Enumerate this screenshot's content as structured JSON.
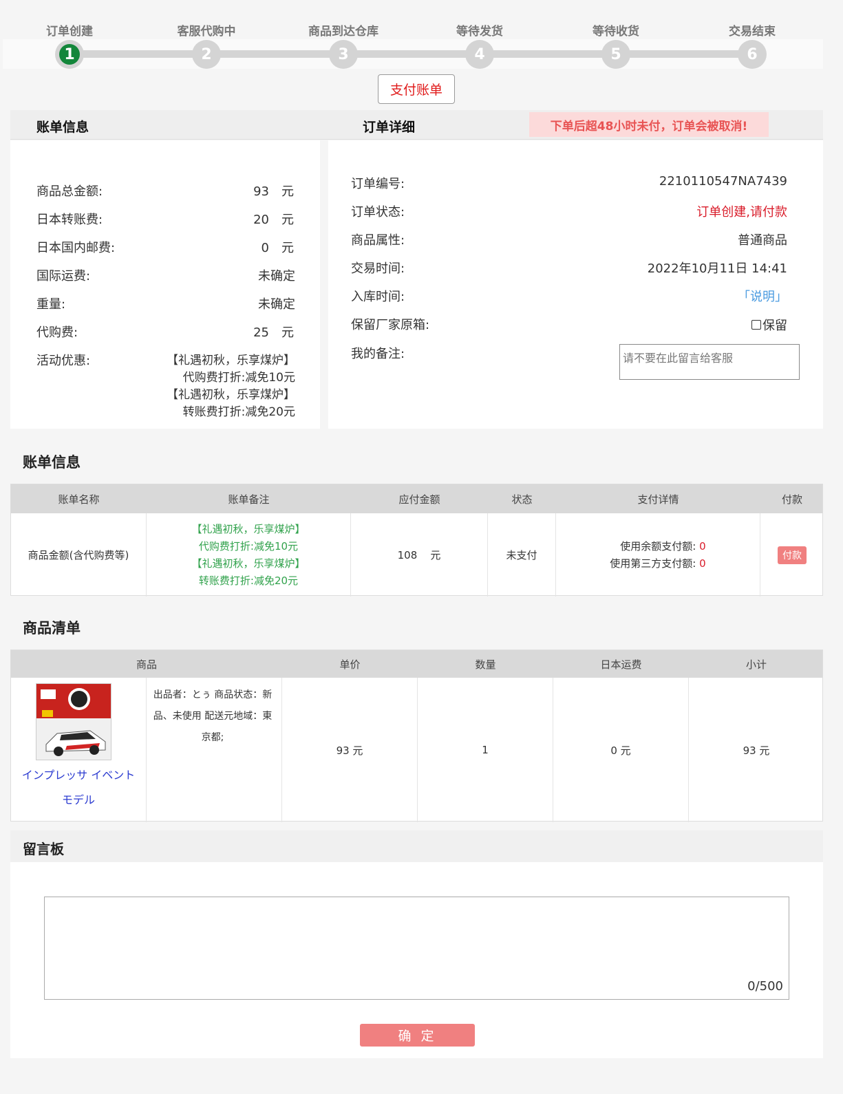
{
  "steps": [
    {
      "label": "订单创建",
      "num": "1"
    },
    {
      "label": "客服代购中",
      "num": "2"
    },
    {
      "label": "商品到达仓库",
      "num": "3"
    },
    {
      "label": "等待发货",
      "num": "4"
    },
    {
      "label": "等待收货",
      "num": "5"
    },
    {
      "label": "交易结束",
      "num": "6"
    }
  ],
  "pay_bill_button": "支付账单",
  "left_panel": {
    "title": "账单信息",
    "rows": [
      {
        "label": "商品总金额:",
        "value": "93",
        "unit": "元"
      },
      {
        "label": "日本转账费:",
        "value": "20",
        "unit": "元"
      },
      {
        "label": "日本国内邮费:",
        "value": "0",
        "unit": "元"
      },
      {
        "label": "国际运费:",
        "value": "未确定",
        "unit": ""
      },
      {
        "label": "重量:",
        "value": "未确定",
        "unit": ""
      },
      {
        "label": "代购费:",
        "value": "25",
        "unit": "元"
      }
    ],
    "promo_label": "活动优惠:",
    "promo_lines": [
      "【礼遇初秋，乐享煤炉】",
      "代购费打折:减免10元",
      "【礼遇初秋，乐享煤炉】",
      "转账费打折:减免20元"
    ]
  },
  "right_panel": {
    "title": "订单详细",
    "warning": "下单后超48小时未付，订单会被取消!",
    "order_no_label": "订单编号:",
    "order_no": "2210110547NA7439",
    "status_label": "订单状态:",
    "status": "订单创建,请付款",
    "attr_label": "商品属性:",
    "attr": "普通商品",
    "time_label": "交易时间:",
    "time": "2022年10月11日 14:41",
    "storage_label": "入库时间:",
    "storage_link": "「说明」",
    "keep_box_label": "保留厂家原箱:",
    "keep_box_option": "保留",
    "remark_label": "我的备注:",
    "remark_placeholder": "请不要在此留言给客服"
  },
  "bill_section": {
    "title": "账单信息",
    "headers": [
      "账单名称",
      "账单备注",
      "应付金额",
      "状态",
      "支付详情",
      "付款"
    ],
    "row": {
      "name": "商品金额(含代购费等)",
      "notes": [
        "【礼遇初秋，乐享煤炉】",
        "代购费打折:减免10元",
        "【礼遇初秋，乐享煤炉】",
        "转账费打折:减免20元"
      ],
      "amount": "108",
      "amount_unit": "元",
      "status": "未支付",
      "balance_label": "使用余额支付额:",
      "balance_value": "0",
      "third_label": "使用第三方支付额:",
      "third_value": "0",
      "pay_button": "付款"
    }
  },
  "goods_section": {
    "title": "商品清单",
    "headers": [
      "商品",
      "单价",
      "数量",
      "日本运费",
      "小计"
    ],
    "row": {
      "name": "インプレッサ イベントモデル",
      "desc": "出品者：とぅ 商品状态：新品、未使用 配送元地域：東京都;",
      "price": "93 元",
      "qty": "1",
      "jp_shipping": "0 元",
      "subtotal": "93 元"
    }
  },
  "message_board": {
    "title": "留言板",
    "counter": "0/500",
    "confirm": "确 定"
  }
}
